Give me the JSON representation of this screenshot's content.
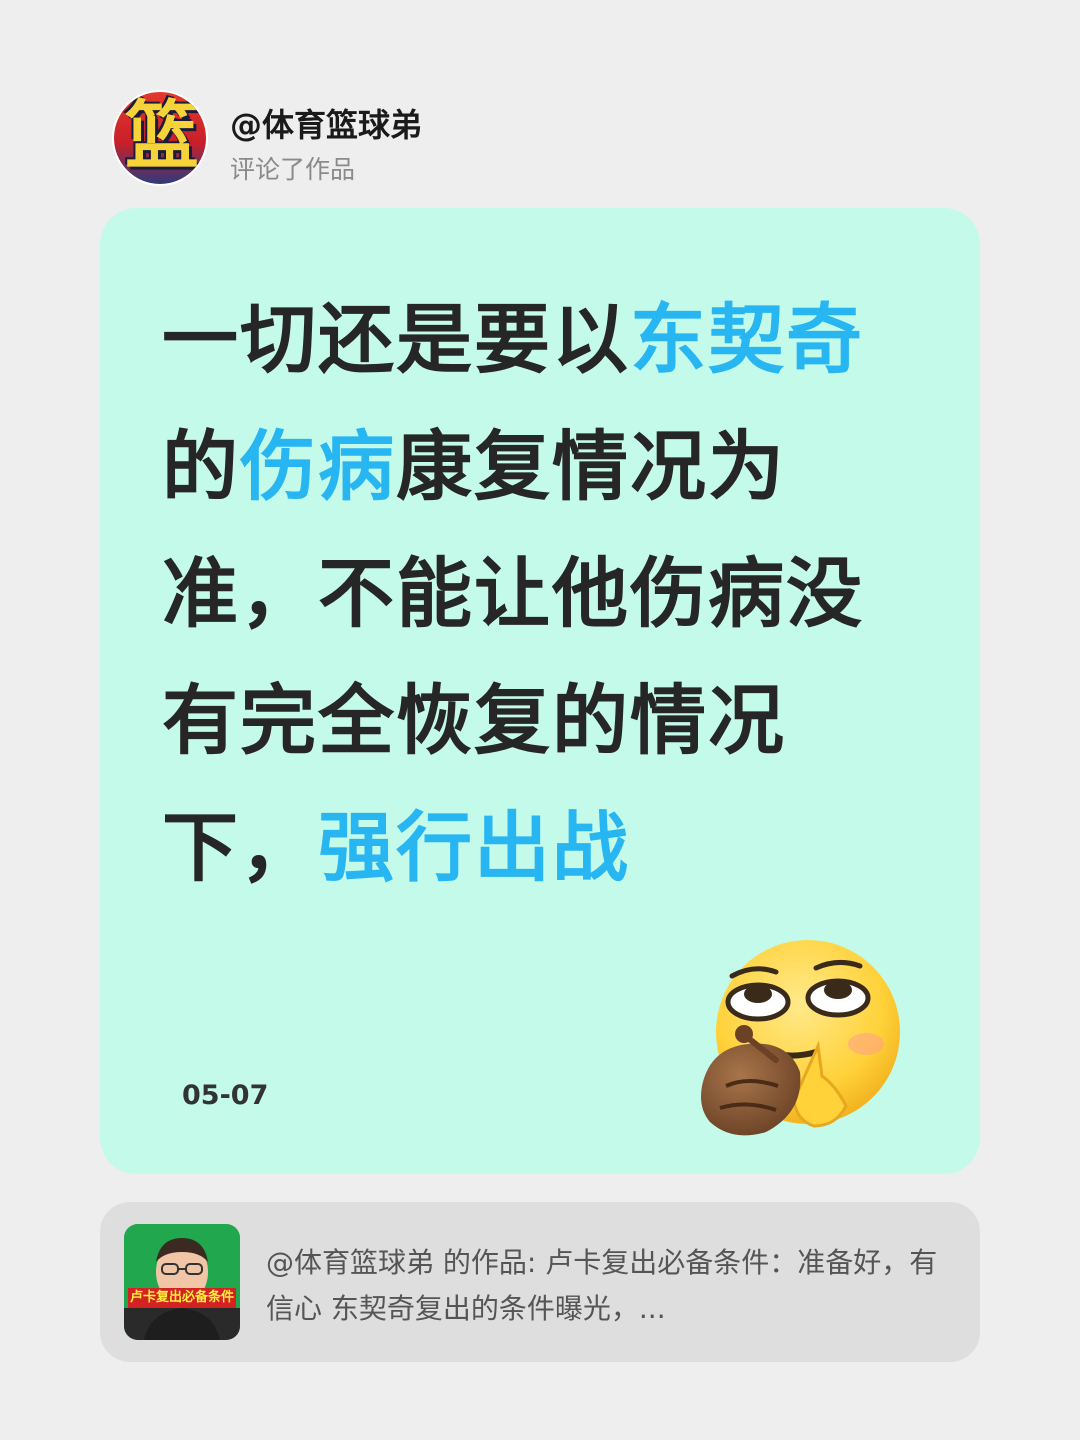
{
  "header": {
    "avatar_text": "篮",
    "user_name": "@体育篮球弟",
    "subtitle": "评论了作品"
  },
  "card": {
    "background": "#c4fae9",
    "highlight_color": "#27b6f2",
    "quote_segments": [
      {
        "text": "一切还是要以",
        "highlight": false
      },
      {
        "text": "东契奇",
        "highlight": true
      },
      {
        "text": "的",
        "highlight": false
      },
      {
        "text": "伤病",
        "highlight": true
      },
      {
        "text": "康复情况为准，不能让他伤病没有完全恢复的情况下，",
        "highlight": false
      },
      {
        "text": "强行出战",
        "highlight": true
      }
    ],
    "date": "05-07",
    "emoji": "eye-roll-smirk-emoji"
  },
  "reference": {
    "thumbnail_caption": "卢卡复出必备条件",
    "text": "@体育篮球弟 的作品: 卢卡复出必备条件：准备好，有信心 东契奇复出的条件曝光，..."
  }
}
